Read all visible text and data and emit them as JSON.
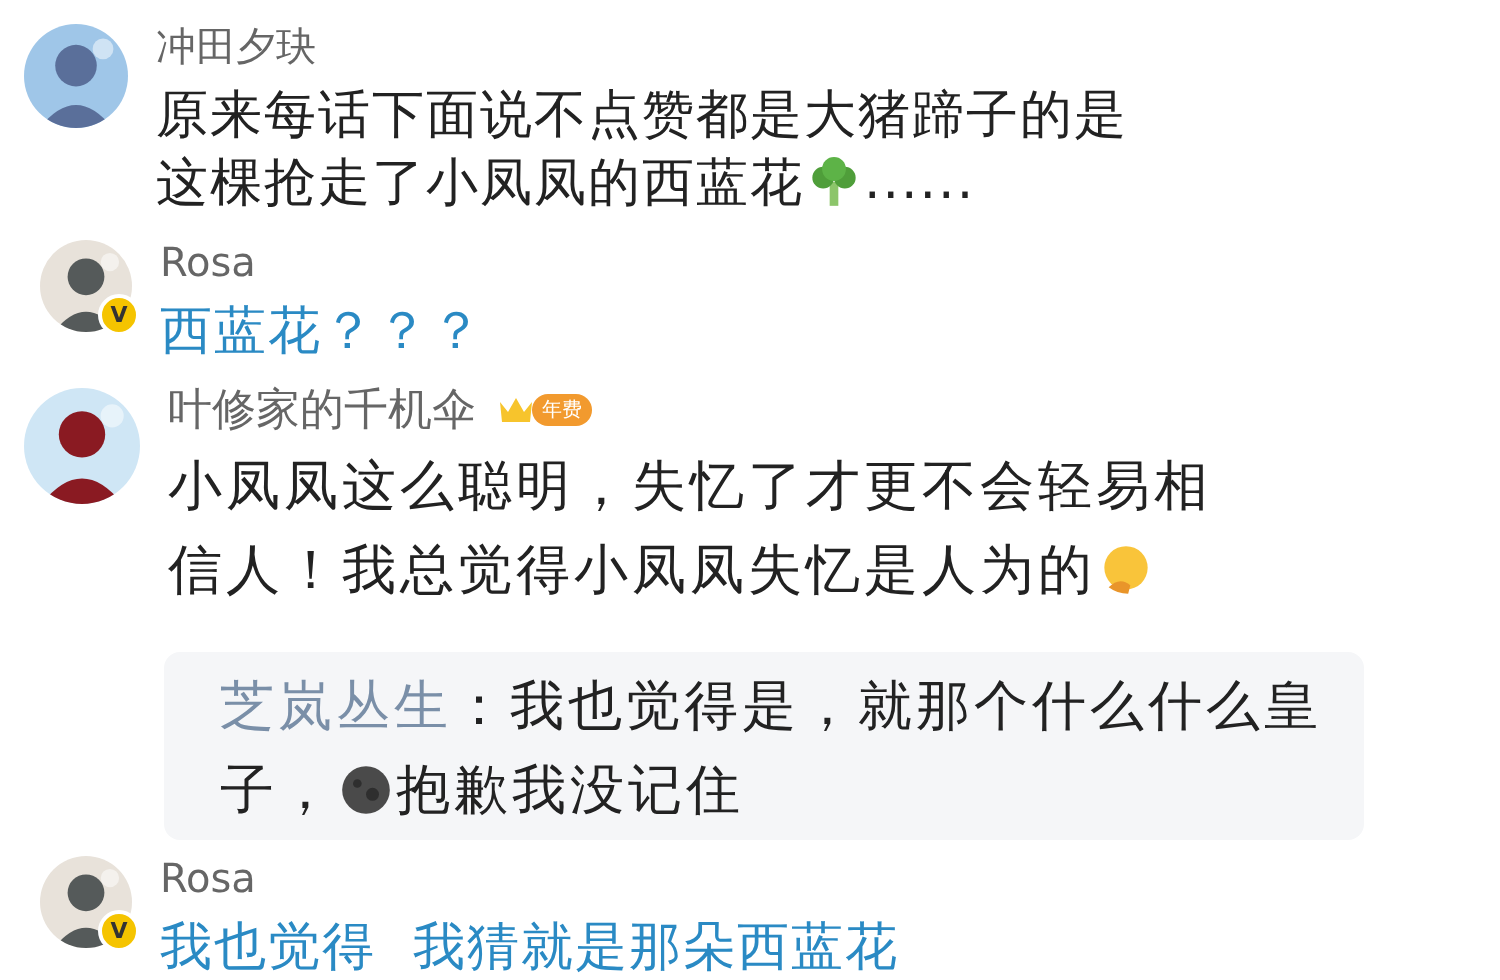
{
  "comments": [
    {
      "author": "冲田夕玦",
      "kind": "plain",
      "lines": [
        [
          {
            "kind": "text",
            "text": "原来每话下面说不点赞都是大猪蹄子的是"
          }
        ],
        [
          {
            "kind": "text",
            "text": "这棵抢走了小凤凤的西蓝花"
          },
          {
            "kind": "broccoli"
          },
          {
            "kind": "text",
            "text": "......"
          }
        ]
      ]
    },
    {
      "author": "Rosa",
      "verified_badge": "V",
      "kind": "reply",
      "lines": [
        [
          {
            "kind": "text",
            "text": "西蓝花？？？"
          }
        ]
      ]
    },
    {
      "author": "叶修家的千机伞",
      "vip_tag": "年费",
      "kind": "plain",
      "lines": [
        [
          {
            "kind": "text",
            "text": "小凤凤这么聪明，失忆了才更不会轻易相"
          }
        ],
        [
          {
            "kind": "text",
            "text": "信人！我总觉得小凤凤失忆是人为的"
          },
          {
            "kind": "thinking"
          }
        ]
      ],
      "replies": [
        {
          "lines": [
            [
              {
                "kind": "author",
                "text": "芝岚丛生"
              },
              {
                "kind": "text",
                "text": "：我也觉得是，就那个什么什么皇"
              }
            ],
            [
              {
                "kind": "text",
                "text": "子，"
              },
              {
                "kind": "moon"
              },
              {
                "kind": "text",
                "text": "抱歉我没记住"
              }
            ]
          ]
        }
      ]
    },
    {
      "author": "Rosa",
      "verified_badge": "V",
      "kind": "reply",
      "lines": [
        [
          {
            "kind": "text",
            "text": "我也觉得  我猜就是那朵西蓝花"
          }
        ]
      ]
    }
  ]
}
